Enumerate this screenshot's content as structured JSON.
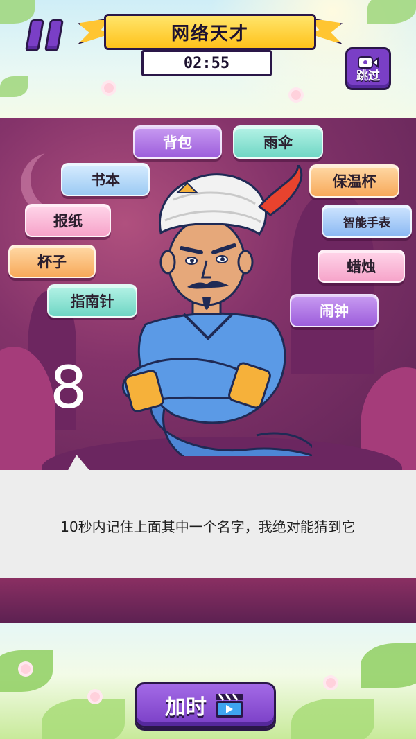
{
  "header": {
    "title": "网络天才",
    "timer": "02:55",
    "skip_label": "跳过"
  },
  "words": [
    "背包",
    "雨伞",
    "书本",
    "保温杯",
    "报纸",
    "智能手表",
    "杯子",
    "蜡烛",
    "指南针",
    "闹钟"
  ],
  "countdown": "8",
  "prompt": "10秒内记住上面其中一个名字，我绝对能猜到它",
  "footer": {
    "add_time_label": "加时"
  },
  "colors": {
    "accent_purple": "#7a3fc6",
    "banner_yellow": "#ffc21b",
    "stage_magenta": "#84336a"
  }
}
